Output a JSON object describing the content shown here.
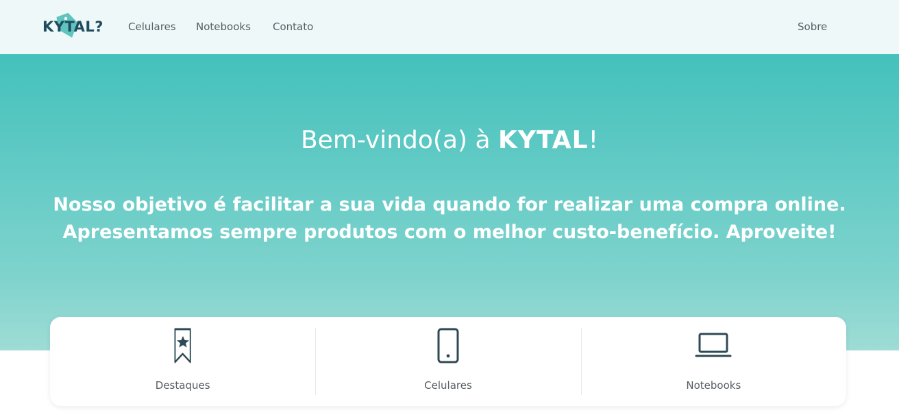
{
  "navbar": {
    "logo_text": "KYTAL?",
    "links": [
      "Celulares",
      "Notebooks",
      "Contato"
    ],
    "right_link": "Sobre"
  },
  "hero": {
    "title_prefix": "Bem-vindo(a) à ",
    "title_brand": "KYTAL",
    "title_suffix": "!",
    "subtitle_line1": "Nosso objetivo é facilitar a sua vida quando for realizar uma compra online.",
    "subtitle_line2": "Apresentamos sempre produtos com o melhor custo-benefício. Aproveite!"
  },
  "categories": [
    {
      "label": "Destaques",
      "icon": "bookmark-star-icon"
    },
    {
      "label": "Celulares",
      "icon": "phone-icon"
    },
    {
      "label": "Notebooks",
      "icon": "laptop-icon"
    }
  ],
  "colors": {
    "navbar_bg": "#eef8f8",
    "hero_top": "#44c1bc",
    "hero_bottom": "#9fdcd6",
    "logo_text": "#1f4b5e",
    "logo_tag": "#5fc4be",
    "icon_stroke": "#2e4a55"
  }
}
